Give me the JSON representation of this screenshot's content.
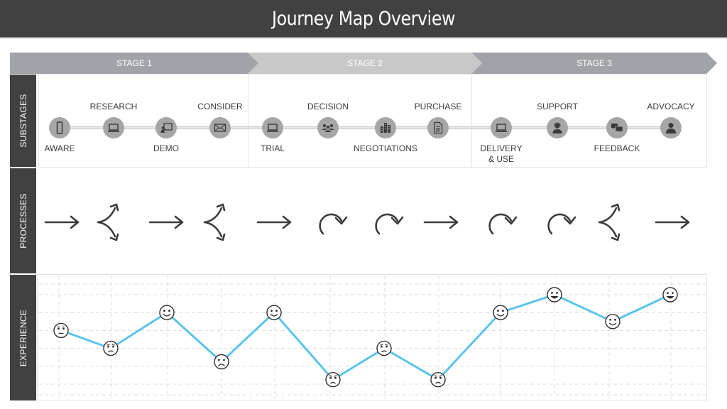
{
  "title": "Journey Map Overview",
  "stages": [
    {
      "label": "STAGE 1",
      "color": "#a0a4a9"
    },
    {
      "label": "STAGE 2",
      "color": "#c8c8c8"
    },
    {
      "label": "STAGE 3",
      "color": "#a0a4a9"
    }
  ],
  "row_labels": {
    "substages": "SUBSTAGES",
    "processes": "PROCESSES",
    "experience": "EXPERIENCE"
  },
  "substages": [
    {
      "label": "AWARE",
      "label_pos": "below",
      "icon": "smartphone-icon",
      "stage": 1
    },
    {
      "label": "RESEARCH",
      "label_pos": "above",
      "icon": "laptop-icon",
      "stage": 1
    },
    {
      "label": "DEMO",
      "label_pos": "below",
      "icon": "presentation-icon",
      "stage": 1
    },
    {
      "label": "CONSIDER",
      "label_pos": "above",
      "icon": "envelope-icon",
      "stage": 1
    },
    {
      "label": "TRIAL",
      "label_pos": "below",
      "icon": "laptop-icon",
      "stage": 2
    },
    {
      "label": "DECISION",
      "label_pos": "above",
      "icon": "group-icon",
      "stage": 2
    },
    {
      "label": "NEGOTIATIONS",
      "label_pos": "below",
      "icon": "buildings-icon",
      "stage": 2
    },
    {
      "label": "PURCHASE",
      "label_pos": "above",
      "icon": "document-icon",
      "stage": 2
    },
    {
      "label": "DELIVERY\n& USE",
      "label_pos": "below",
      "icon": "laptop-icon",
      "stage": 3
    },
    {
      "label": "SUPPORT",
      "label_pos": "above",
      "icon": "headset-agent-icon",
      "stage": 3
    },
    {
      "label": "FEEDBACK",
      "label_pos": "below",
      "icon": "chat-bubbles-icon",
      "stage": 3
    },
    {
      "label": "ADVOCACY",
      "label_pos": "above",
      "icon": "person-icon",
      "stage": 3
    }
  ],
  "processes": [
    "straight-arrow-icon",
    "split-arrow-icon",
    "straight-arrow-icon",
    "split-arrow-icon",
    "straight-arrow-icon",
    "loop-arrow-icon",
    "loop-arrow-icon",
    "straight-arrow-icon",
    "loop-arrow-icon",
    "loop-arrow-icon",
    "split-arrow-icon",
    "straight-arrow-icon"
  ],
  "colors": {
    "title_bg": "#414141",
    "row_label_bg": "#414141",
    "node_fill": "#a6a6a6",
    "icon_fill": "#3a3a3a",
    "line": "#5bc4ea",
    "grid": "#dcdcdc"
  },
  "chart_data": {
    "type": "line",
    "title": "Experience",
    "categories": [
      "AWARE",
      "RESEARCH",
      "DEMO",
      "CONSIDER",
      "TRIAL",
      "DECISION",
      "NEGOTIATIONS",
      "PURCHASE",
      "DELIVERY & USE",
      "SUPPORT",
      "FEEDBACK",
      "ADVOCACY"
    ],
    "values": [
      4,
      3,
      5,
      2.25,
      5,
      1.25,
      3,
      1.25,
      5,
      6,
      4.5,
      6
    ],
    "markers": [
      "neutral",
      "worried",
      "smile",
      "sad",
      "smile",
      "angry",
      "worried",
      "angry",
      "smile",
      "grin",
      "smile",
      "grin"
    ],
    "ylim": [
      0,
      7
    ],
    "grid": true,
    "xlabel": "",
    "ylabel": ""
  }
}
